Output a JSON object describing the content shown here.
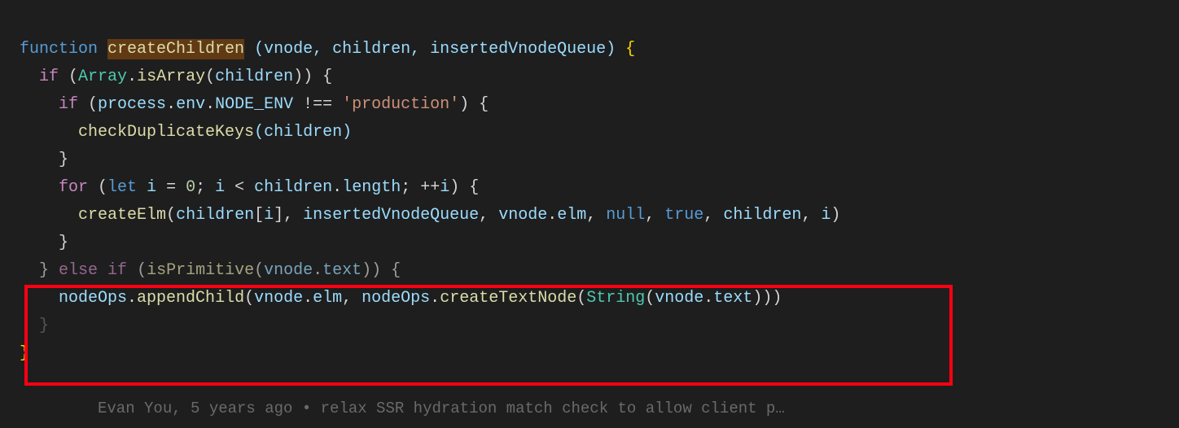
{
  "code": {
    "line1": {
      "kw_function": "function",
      "fn_name": "createChildren",
      "params": " (vnode, children, insertedVnodeQueue) ",
      "open_brace": "{"
    },
    "line2": {
      "indent": "  ",
      "kw_if": "if",
      "paren_open": " (",
      "class_array": "Array",
      "dot": ".",
      "method": "isArray",
      "call_open": "(",
      "arg": "children",
      "call_close": "))",
      "brace": " {"
    },
    "line3": {
      "indent": "    ",
      "kw_if": "if",
      "text": " (",
      "process": "process",
      "dot1": ".",
      "env": "env",
      "dot2": ".",
      "node_env": "NODE_ENV",
      "neq": " !== ",
      "str": "'production'",
      "close": ") {"
    },
    "line4": {
      "indent": "      ",
      "fn": "checkDuplicateKeys",
      "args": "(children)"
    },
    "line5": {
      "indent": "    ",
      "brace": "}"
    },
    "line6": {
      "indent": "    ",
      "kw_for": "for",
      "open": " (",
      "kw_let": "let",
      "var_i": " i ",
      "eq": "= ",
      "zero": "0",
      "semi1": "; ",
      "i2": "i",
      "lt": " < ",
      "children": "children",
      "dot": ".",
      "length": "length",
      "semi2": "; ++",
      "i3": "i",
      "close": ") {"
    },
    "line7": {
      "indent": "      ",
      "fn": "createElm",
      "open": "(",
      "children": "children",
      "bracket_open": "[",
      "i": "i",
      "bracket_close": "], ",
      "ivq": "insertedVnodeQueue",
      "comma1": ", ",
      "vnode": "vnode",
      "dot1": ".",
      "elm": "elm",
      "comma2": ", ",
      "null": "null",
      "comma3": ", ",
      "true": "true",
      "comma4": ", ",
      "children2": "children",
      "comma5": ", ",
      "i2": "i",
      "close": ")"
    },
    "line8": {
      "indent": "    ",
      "brace": "}"
    },
    "line9": {
      "indent": "  ",
      "close_brace": "}",
      "kw_else": " else if ",
      "open": "(",
      "fn": "isPrimitive",
      "call_open": "(",
      "vnode": "vnode",
      "dot": ".",
      "text": "text",
      "close": ")) {"
    },
    "line10": {
      "indent": "    ",
      "nodeops": "nodeOps",
      "dot1": ".",
      "append": "appendChild",
      "open": "(",
      "vnode1": "vnode",
      "dot2": ".",
      "elm": "elm",
      "comma": ", ",
      "nodeops2": "nodeOps",
      "dot3": ".",
      "create": "createTextNode",
      "open2": "(",
      "string_cls": "String",
      "open3": "(",
      "vnode2": "vnode",
      "dot4": ".",
      "text": "text",
      "close": ")))"
    },
    "line11": {
      "indent": "  ",
      "brace": "}"
    },
    "line12": {
      "brace": "}"
    }
  },
  "git_blame": "Evan You, 5 years ago • relax SSR hydration match check to allow client p…"
}
